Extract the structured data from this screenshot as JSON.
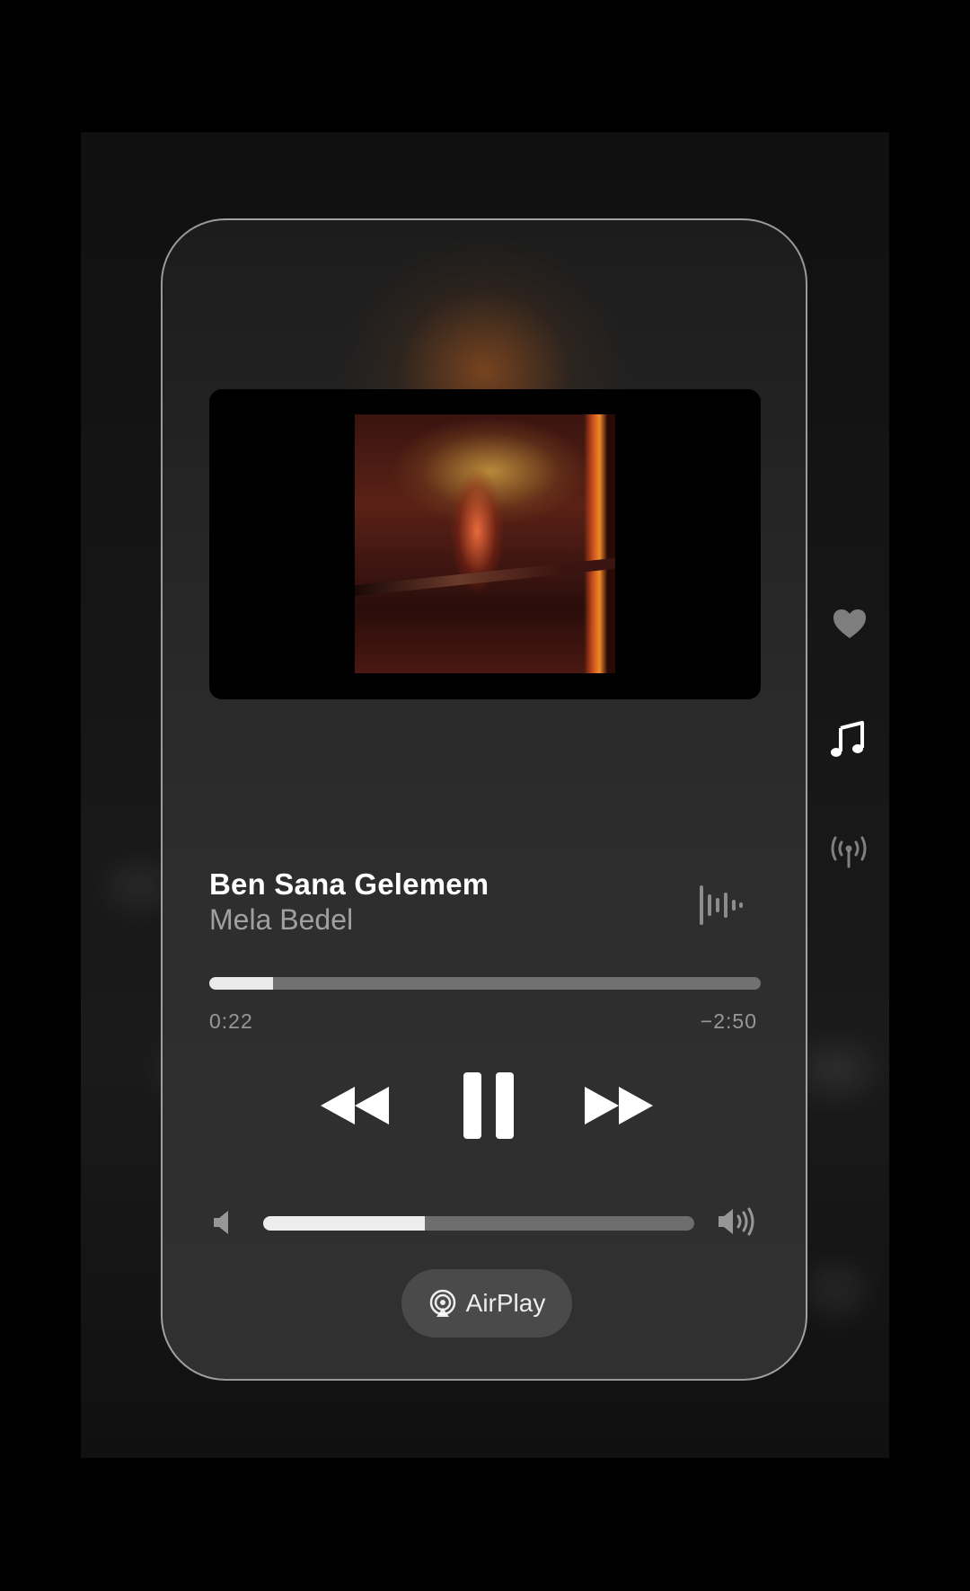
{
  "now_playing": {
    "title": "Ben Sana Gelemem",
    "artist": "Mela Bedel",
    "elapsed": "0:22",
    "remaining": "−2:50",
    "progress_fraction": 0.115,
    "volume_fraction": 0.375
  },
  "controls": {
    "rewind_icon": "backward-icon",
    "pause_icon": "pause-icon",
    "forward_icon": "forward-icon",
    "volume_low_icon": "speaker-low-icon",
    "volume_high_icon": "speaker-high-icon",
    "waveform_icon": "waveform-icon"
  },
  "airplay": {
    "label": "AirPlay",
    "icon": "airplay-icon"
  },
  "side_menu": [
    {
      "icon": "heart-icon",
      "active": false
    },
    {
      "icon": "music-note-icon",
      "active": true
    },
    {
      "icon": "broadcast-icon",
      "active": false
    }
  ],
  "colors": {
    "background": "#000000",
    "card": "#2a2a2a",
    "accent_glow": "#be5f1e"
  }
}
